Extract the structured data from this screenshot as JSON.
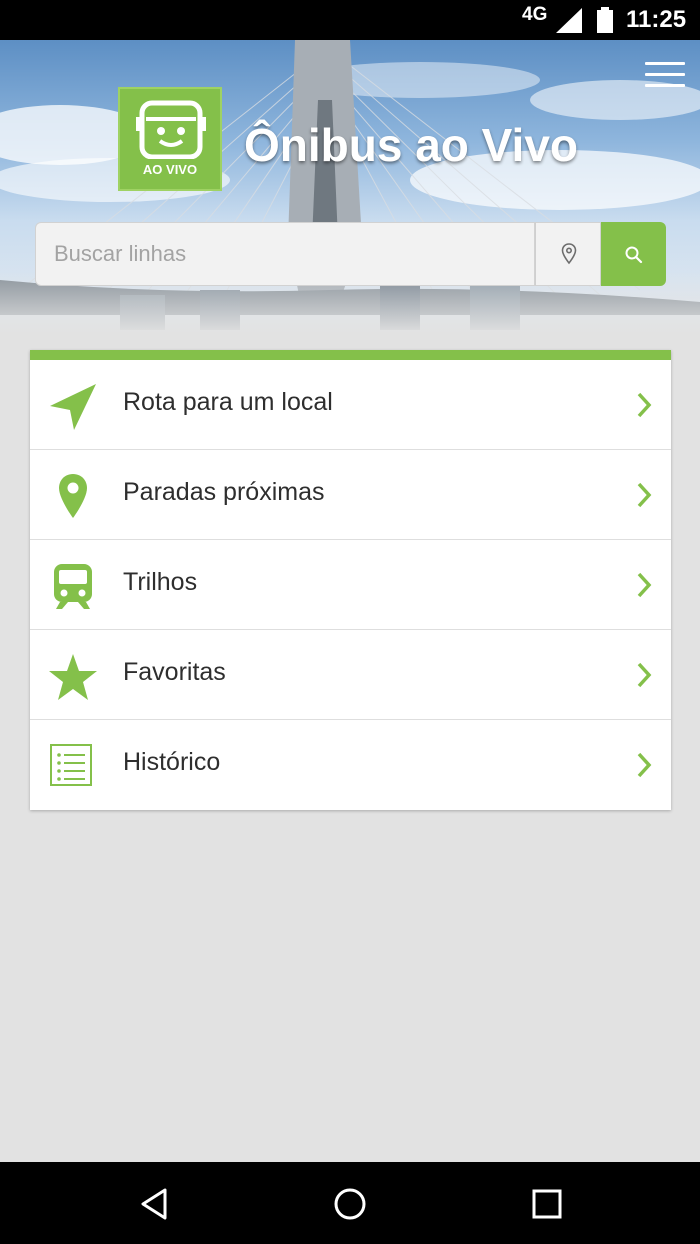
{
  "status_bar": {
    "network": "4G",
    "time": "11:25"
  },
  "header": {
    "title": "Ônibus ao Vivo",
    "logo_text": "AO VIVO",
    "menu_icon": "hamburger-menu-icon"
  },
  "search": {
    "placeholder": "Buscar linhas",
    "location_icon": "location-pin-icon",
    "search_icon": "magnifier-icon"
  },
  "menu": {
    "items": [
      {
        "label": "Rota para um local",
        "icon": "navigation-arrow-icon"
      },
      {
        "label": "Paradas próximas",
        "icon": "map-pin-icon"
      },
      {
        "label": "Trilhos",
        "icon": "train-icon"
      },
      {
        "label": "Favoritas",
        "icon": "star-icon"
      },
      {
        "label": "Histórico",
        "icon": "list-icon"
      }
    ]
  },
  "colors": {
    "accent": "#84c04a",
    "background": "#e2e2e2",
    "text": "#2e2e2e"
  }
}
